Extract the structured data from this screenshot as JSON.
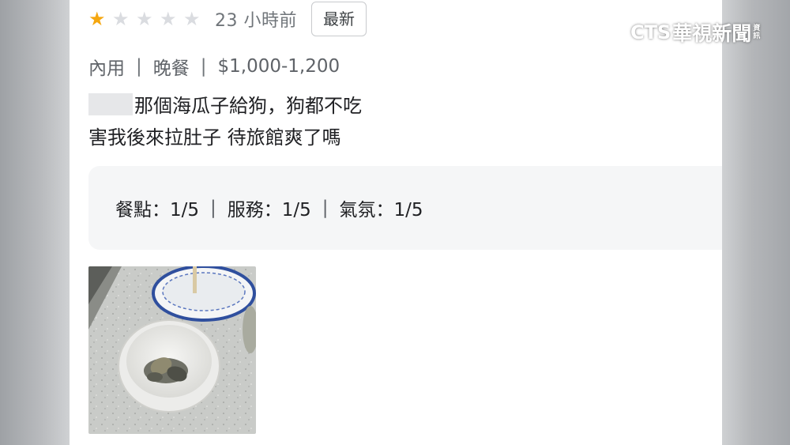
{
  "review": {
    "stars_filled": 1,
    "stars_total": 5,
    "time_ago": "23 小時前",
    "newest_label": "最新",
    "meta": {
      "dining_type": "內用",
      "meal": "晚餐",
      "price": "$1,000-1,200"
    },
    "text_line1": "那個海瓜子給狗，狗都不吃",
    "text_line2": "害我後來拉肚子 待旅館爽了嗎",
    "subratings": {
      "food": "餐點：1/5",
      "service": "服務：1/5",
      "atmosphere": "氣氛：1/5"
    }
  },
  "meta_separator": "|",
  "colors": {
    "star_filled": "#f5a70f",
    "star_empty": "#dadce0",
    "subratings_bg": "#f5f6f7"
  },
  "watermark": {
    "brand": "CTS",
    "name": "華視新聞",
    "small_top": "資",
    "small_bottom": "訊"
  }
}
